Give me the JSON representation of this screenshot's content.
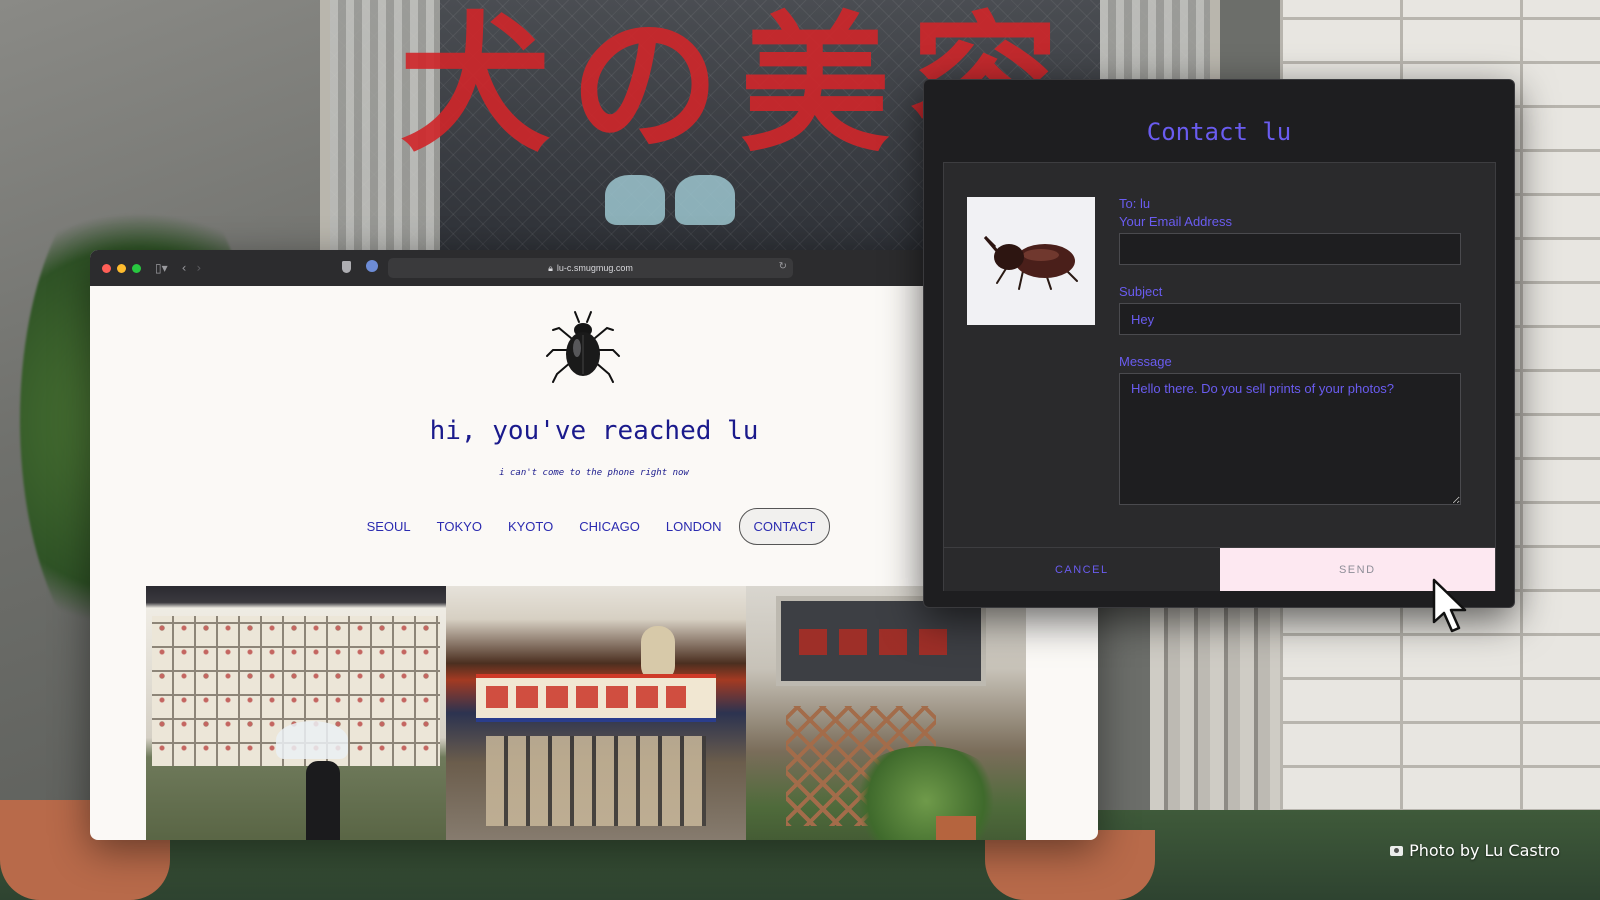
{
  "browser": {
    "url": "lu-c.smugmug.com",
    "traffic_lights": [
      "#ff5f57",
      "#febc2e",
      "#28c840"
    ]
  },
  "site": {
    "title": "hi, you've reached lu",
    "subtitle": "i can't come to the phone right now",
    "nav": [
      "SEOUL",
      "TOKYO",
      "KYOTO",
      "CHICAGO",
      "LONDON",
      "CONTACT"
    ],
    "active_nav": "CONTACT",
    "accent_color": "#1a1a8c"
  },
  "modal": {
    "title": "Contact lu",
    "to_label": "To: lu",
    "email_label": "Your Email Address",
    "email_value": "",
    "subject_label": "Subject",
    "subject_value": "Hey",
    "message_label": "Message",
    "message_value": "Hello there. Do you sell prints of your photos?",
    "cancel_label": "CANCEL",
    "send_label": "SEND",
    "accent_color": "#6a5cf0"
  },
  "background": {
    "kanji": "犬の美容",
    "credit": "Photo by Lu Castro"
  }
}
